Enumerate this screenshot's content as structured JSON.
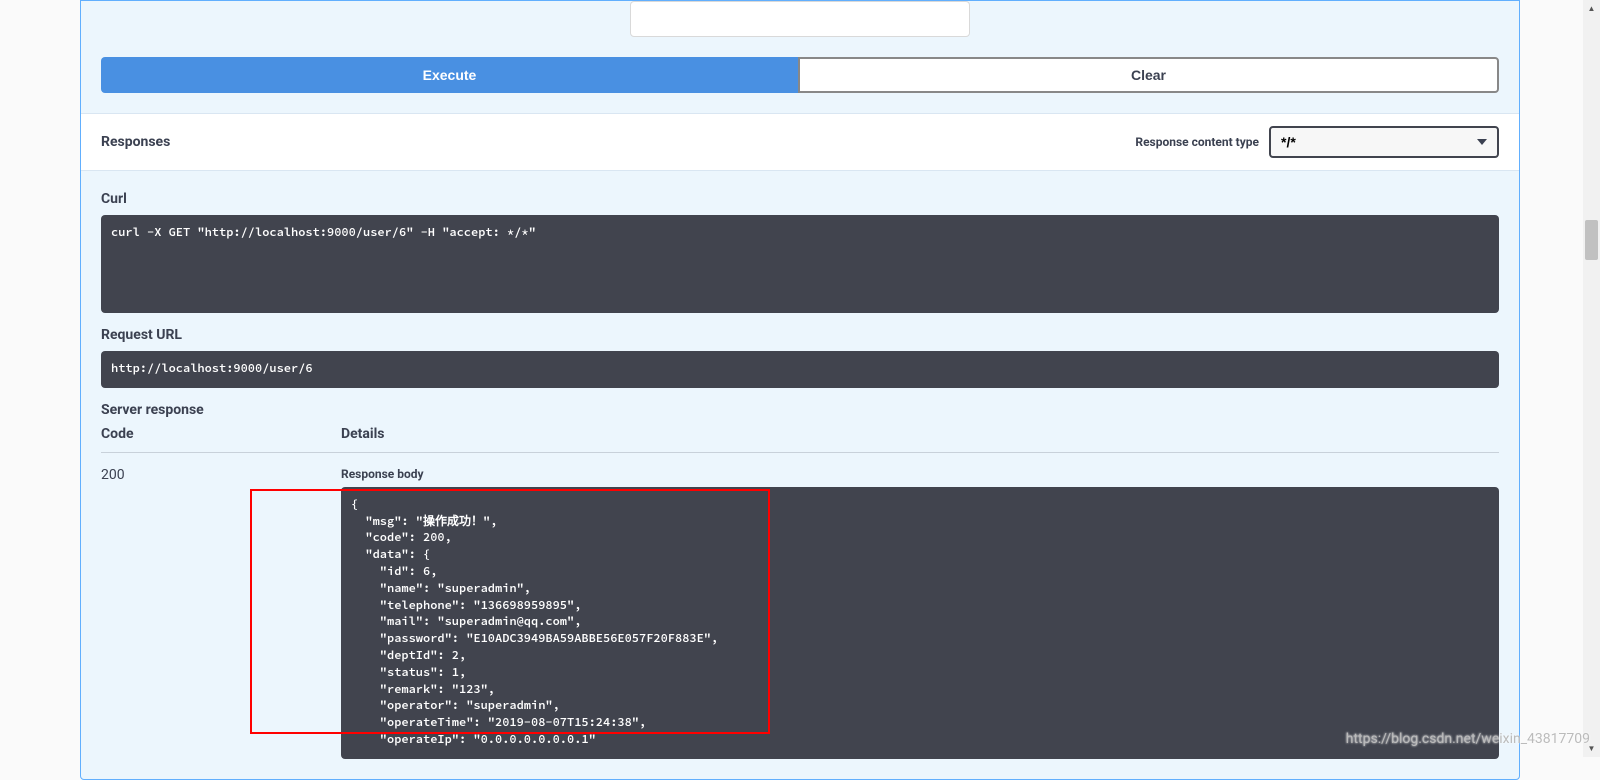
{
  "buttons": {
    "execute": "Execute",
    "clear": "Clear"
  },
  "responses": {
    "heading": "Responses",
    "content_type_label": "Response content type",
    "content_type_value": "*/*"
  },
  "curl": {
    "label": "Curl",
    "command": "curl -X GET \"http://localhost:9000/user/6\" -H \"accept: */*\""
  },
  "request_url": {
    "label": "Request URL",
    "value": "http://localhost:9000/user/6"
  },
  "server_response": {
    "label": "Server response",
    "columns": {
      "code": "Code",
      "details": "Details"
    },
    "code": "200",
    "body_label": "Response body",
    "body": "{\n  \"msg\": \"操作成功！\",\n  \"code\": 200,\n  \"data\": {\n    \"id\": 6,\n    \"name\": \"superadmin\",\n    \"telephone\": \"136698959895\",\n    \"mail\": \"superadmin@qq.com\",\n    \"password\": \"E10ADC3949BA59ABBE56E057F20F883E\",\n    \"deptId\": 2,\n    \"status\": 1,\n    \"remark\": \"123\",\n    \"operator\": \"superadmin\",\n    \"operateTime\": \"2019-08-07T15:24:38\",\n    \"operateIp\": \"0.0.0.0.0.0.0.1\""
  },
  "watermark": "https://blog.csdn.net/weixin_43817709"
}
